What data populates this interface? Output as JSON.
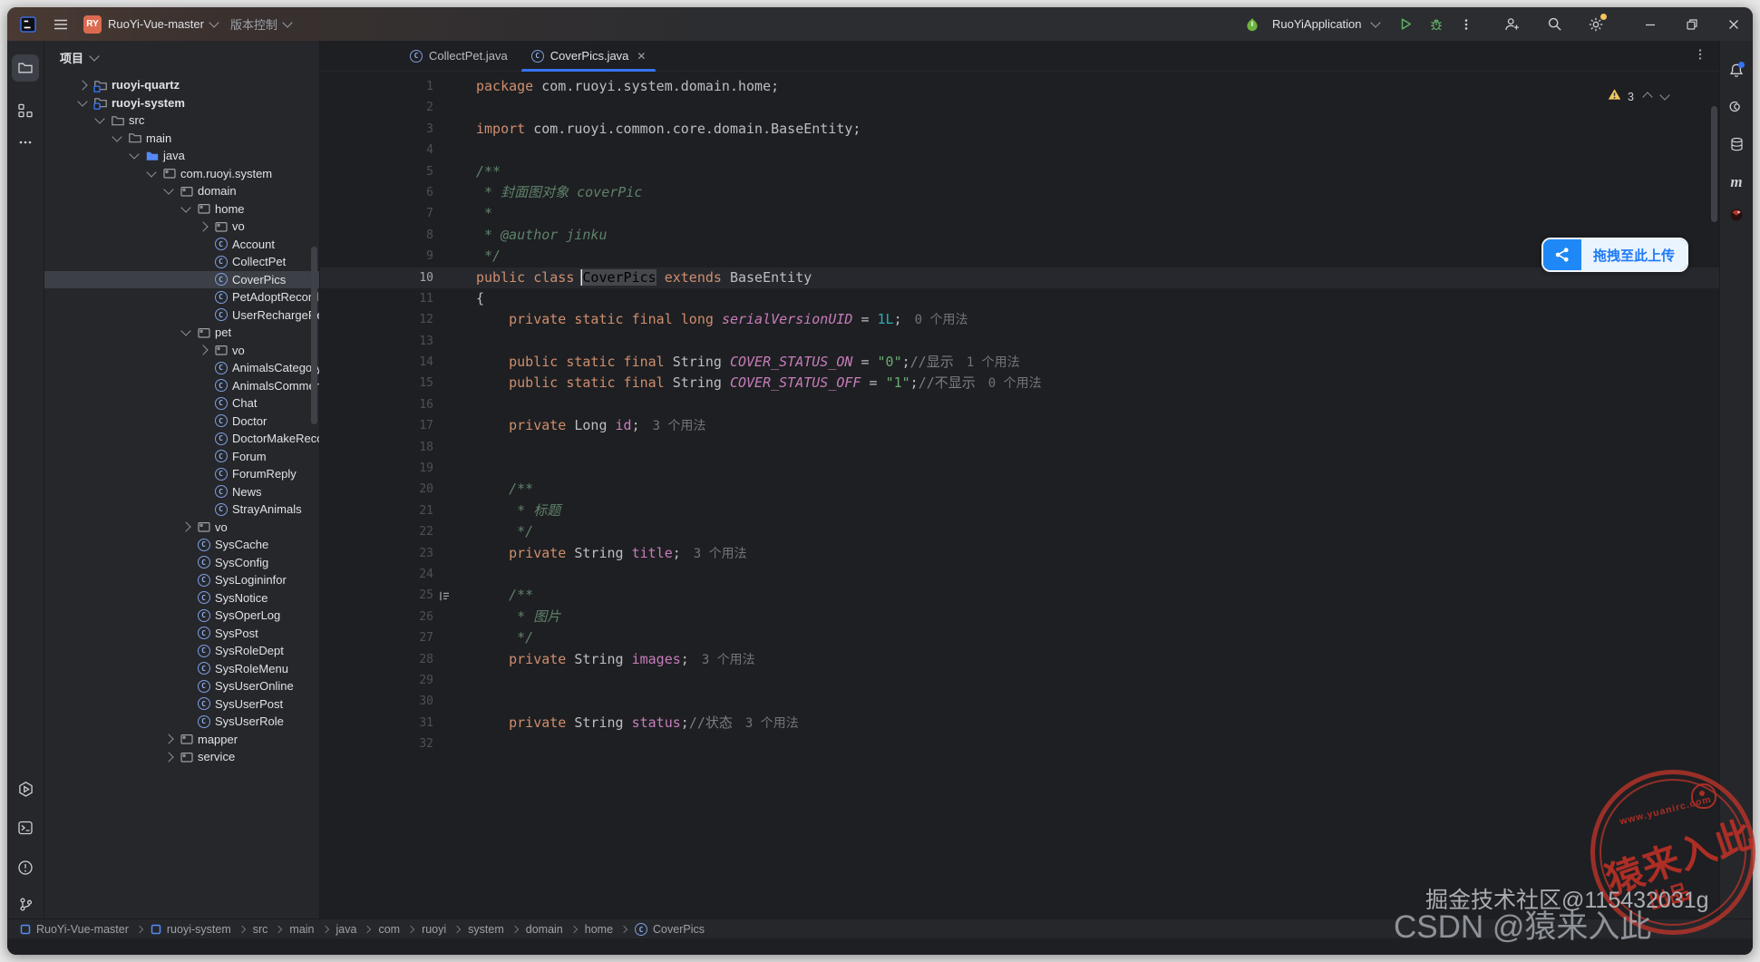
{
  "colors": {
    "accent": "#3574F0",
    "warning": "#F2C55C",
    "stamp_red": "#BA342A",
    "selection": "#3C3F45"
  },
  "title_bar": {
    "app_icon": "intellij-logo",
    "project_badge": "RY",
    "project_name": "RuoYi-Vue-master",
    "vcs_label": "版本控制",
    "run_config": "RuoYiApplication",
    "right_icons": [
      "add-user",
      "search",
      "settings",
      "minimize",
      "restore",
      "close"
    ]
  },
  "left_toolbar": {
    "top_icons": [
      "project-folder",
      "structure",
      "more-dots"
    ],
    "bottom_icons": [
      "run-hexagon",
      "terminal",
      "problems",
      "version-control"
    ]
  },
  "right_toolbar": {
    "icons": [
      "notifications-bell",
      "ai-assistant",
      "database",
      "maven",
      "plugin"
    ]
  },
  "project_panel": {
    "header": "项目",
    "items": [
      {
        "label": "ruoyi-quartz",
        "level": 0,
        "icon": "module",
        "expand": "closed",
        "bold": true
      },
      {
        "label": "ruoyi-system",
        "level": 0,
        "icon": "module",
        "expand": "open",
        "bold": true
      },
      {
        "label": "src",
        "level": 1,
        "icon": "folder",
        "expand": "open"
      },
      {
        "label": "main",
        "level": 2,
        "icon": "folder",
        "expand": "open"
      },
      {
        "label": "java",
        "level": 3,
        "icon": "source-root",
        "expand": "open"
      },
      {
        "label": "com.ruoyi.system",
        "level": 4,
        "icon": "package",
        "expand": "open"
      },
      {
        "label": "domain",
        "level": 5,
        "icon": "package",
        "expand": "open"
      },
      {
        "label": "home",
        "level": 6,
        "icon": "package",
        "expand": "open"
      },
      {
        "label": "vo",
        "level": 7,
        "icon": "package",
        "expand": "closed"
      },
      {
        "label": "Account",
        "level": 7,
        "icon": "class"
      },
      {
        "label": "CollectPet",
        "level": 7,
        "icon": "class"
      },
      {
        "label": "CoverPics",
        "level": 7,
        "icon": "class",
        "selected": true
      },
      {
        "label": "PetAdoptRecord",
        "level": 7,
        "icon": "class"
      },
      {
        "label": "UserRechargeRecord",
        "level": 7,
        "icon": "class"
      },
      {
        "label": "pet",
        "level": 6,
        "icon": "package",
        "expand": "open"
      },
      {
        "label": "vo",
        "level": 7,
        "icon": "package",
        "expand": "closed"
      },
      {
        "label": "AnimalsCategory",
        "level": 7,
        "icon": "class"
      },
      {
        "label": "AnimalsComment",
        "level": 7,
        "icon": "class"
      },
      {
        "label": "Chat",
        "level": 7,
        "icon": "class"
      },
      {
        "label": "Doctor",
        "level": 7,
        "icon": "class"
      },
      {
        "label": "DoctorMakeRecord",
        "level": 7,
        "icon": "class"
      },
      {
        "label": "Forum",
        "level": 7,
        "icon": "class"
      },
      {
        "label": "ForumReply",
        "level": 7,
        "icon": "class"
      },
      {
        "label": "News",
        "level": 7,
        "icon": "class"
      },
      {
        "label": "StrayAnimals",
        "level": 7,
        "icon": "class"
      },
      {
        "label": "vo",
        "level": 6,
        "icon": "package",
        "expand": "closed"
      },
      {
        "label": "SysCache",
        "level": 6,
        "icon": "class"
      },
      {
        "label": "SysConfig",
        "level": 6,
        "icon": "class"
      },
      {
        "label": "SysLogininfor",
        "level": 6,
        "icon": "class"
      },
      {
        "label": "SysNotice",
        "level": 6,
        "icon": "class"
      },
      {
        "label": "SysOperLog",
        "level": 6,
        "icon": "class"
      },
      {
        "label": "SysPost",
        "level": 6,
        "icon": "class"
      },
      {
        "label": "SysRoleDept",
        "level": 6,
        "icon": "class"
      },
      {
        "label": "SysRoleMenu",
        "level": 6,
        "icon": "class"
      },
      {
        "label": "SysUserOnline",
        "level": 6,
        "icon": "class"
      },
      {
        "label": "SysUserPost",
        "level": 6,
        "icon": "class"
      },
      {
        "label": "SysUserRole",
        "level": 6,
        "icon": "class"
      },
      {
        "label": "mapper",
        "level": 5,
        "icon": "package",
        "expand": "closed"
      },
      {
        "label": "service",
        "level": 5,
        "icon": "package",
        "expand": "closed"
      }
    ]
  },
  "editor": {
    "tabs": [
      {
        "label": "CollectPet.java",
        "active": false,
        "closable": false
      },
      {
        "label": "CoverPics.java",
        "active": true,
        "closable": true
      }
    ],
    "inspections": {
      "warning_count": "3"
    },
    "lines": [
      {
        "n": 1,
        "tokens": [
          [
            "k",
            "package"
          ],
          [
            "d",
            " com.ruoyi.system.domain.home;"
          ]
        ]
      },
      {
        "n": 2,
        "tokens": []
      },
      {
        "n": 3,
        "tokens": [
          [
            "k",
            "import"
          ],
          [
            "d",
            " com.ruoyi.common.core.domain.BaseEntity;"
          ]
        ]
      },
      {
        "n": 4,
        "tokens": []
      },
      {
        "n": 5,
        "tokens": [
          [
            "doc",
            "/**"
          ]
        ]
      },
      {
        "n": 6,
        "tokens": [
          [
            "doc",
            " * 封面图对象 coverPic"
          ]
        ]
      },
      {
        "n": 7,
        "tokens": [
          [
            "doc",
            " *"
          ]
        ]
      },
      {
        "n": 8,
        "tokens": [
          [
            "doc",
            " * @author jinku"
          ]
        ]
      },
      {
        "n": 9,
        "tokens": [
          [
            "doc",
            " */"
          ]
        ]
      },
      {
        "n": 10,
        "cur": true,
        "tokens": [
          [
            "k",
            "public class "
          ],
          [
            "hl",
            "CoverPics"
          ],
          [
            "d",
            " "
          ],
          [
            "k",
            "extends"
          ],
          [
            "d",
            " BaseEntity"
          ]
        ]
      },
      {
        "n": 11,
        "tokens": [
          [
            "d",
            "{"
          ]
        ]
      },
      {
        "n": 12,
        "tokens": [
          [
            "d",
            "    "
          ],
          [
            "k",
            "private static final long "
          ],
          [
            "sf",
            "serialVersionUID"
          ],
          [
            "d",
            " = "
          ],
          [
            "n",
            "1L"
          ],
          [
            "d",
            ";"
          ],
          [
            "i",
            "0 个用法"
          ]
        ]
      },
      {
        "n": 13,
        "tokens": []
      },
      {
        "n": 14,
        "tokens": [
          [
            "d",
            "    "
          ],
          [
            "k",
            "public static final "
          ],
          [
            "d",
            "String "
          ],
          [
            "sf",
            "COVER_STATUS_ON"
          ],
          [
            "d",
            " = "
          ],
          [
            "s",
            "\"0\""
          ],
          [
            "d",
            ";"
          ],
          [
            "c",
            "//显示"
          ],
          [
            "i",
            "1 个用法"
          ]
        ]
      },
      {
        "n": 15,
        "tokens": [
          [
            "d",
            "    "
          ],
          [
            "k",
            "public static final "
          ],
          [
            "d",
            "String "
          ],
          [
            "sf",
            "COVER_STATUS_OFF"
          ],
          [
            "d",
            " = "
          ],
          [
            "s",
            "\"1\""
          ],
          [
            "d",
            ";"
          ],
          [
            "c",
            "//不显示"
          ],
          [
            "i",
            "0 个用法"
          ]
        ]
      },
      {
        "n": 16,
        "tokens": []
      },
      {
        "n": 17,
        "tokens": [
          [
            "d",
            "    "
          ],
          [
            "k",
            "private "
          ],
          [
            "d",
            "Long "
          ],
          [
            "f",
            "id"
          ],
          [
            "d",
            ";"
          ],
          [
            "i",
            "3 个用法"
          ]
        ]
      },
      {
        "n": 18,
        "tokens": []
      },
      {
        "n": 19,
        "tokens": []
      },
      {
        "n": 20,
        "tokens": [
          [
            "doc",
            "    /**"
          ]
        ]
      },
      {
        "n": 21,
        "tokens": [
          [
            "doc",
            "     * 标题"
          ]
        ]
      },
      {
        "n": 22,
        "tokens": [
          [
            "doc",
            "     */"
          ]
        ]
      },
      {
        "n": 23,
        "tokens": [
          [
            "d",
            "    "
          ],
          [
            "k",
            "private "
          ],
          [
            "d",
            "String "
          ],
          [
            "f",
            "title"
          ],
          [
            "d",
            ";"
          ],
          [
            "i",
            "3 个用法"
          ]
        ]
      },
      {
        "n": 24,
        "tokens": []
      },
      {
        "n": 25,
        "gutter": "format-marker",
        "tokens": [
          [
            "doc",
            "    /**"
          ]
        ]
      },
      {
        "n": 26,
        "tokens": [
          [
            "doc",
            "     * 图片"
          ]
        ]
      },
      {
        "n": 27,
        "tokens": [
          [
            "doc",
            "     */"
          ]
        ]
      },
      {
        "n": 28,
        "tokens": [
          [
            "d",
            "    "
          ],
          [
            "k",
            "private "
          ],
          [
            "d",
            "String "
          ],
          [
            "f",
            "images"
          ],
          [
            "d",
            ";"
          ],
          [
            "i",
            "3 个用法"
          ]
        ]
      },
      {
        "n": 29,
        "tokens": []
      },
      {
        "n": 30,
        "tokens": []
      },
      {
        "n": 31,
        "tokens": [
          [
            "d",
            "    "
          ],
          [
            "k",
            "private "
          ],
          [
            "d",
            "String "
          ],
          [
            "f",
            "status"
          ],
          [
            "d",
            ";"
          ],
          [
            "c",
            "//状态"
          ],
          [
            "i",
            "3 个用法"
          ]
        ]
      },
      {
        "n": 32,
        "tokens": []
      }
    ]
  },
  "upload_overlay": {
    "label": "拖拽至此上传",
    "icon": "share-nodes"
  },
  "breadcrumbs": [
    {
      "label": "RuoYi-Vue-master",
      "icon": "module"
    },
    {
      "label": "ruoyi-system",
      "icon": "module"
    },
    {
      "label": "src"
    },
    {
      "label": "main"
    },
    {
      "label": "java"
    },
    {
      "label": "com"
    },
    {
      "label": "ruoyi"
    },
    {
      "label": "system"
    },
    {
      "label": "domain"
    },
    {
      "label": "home"
    },
    {
      "label": "CoverPics",
      "icon": "class"
    }
  ],
  "watermarks": {
    "stamp": {
      "line1": "猿来入此",
      "line2": "出品",
      "arc": "www.yuanirc.com"
    },
    "juejin": "掘金技术社区@115432031g",
    "csdn": "CSDN @猿来入此"
  }
}
